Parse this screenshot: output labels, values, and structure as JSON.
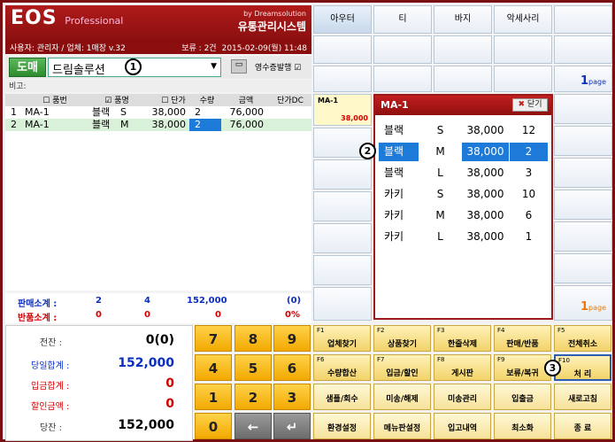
{
  "header": {
    "logo": "EOS",
    "logo_sub": "Professional",
    "by": "by Dreamsolution",
    "system": "유통관리시스템",
    "user_info": "사용자: 관리자 / 업체: 1매장 v.32",
    "hold": "보류 : 2건",
    "datetime": "2015-02-09(월) 11:48"
  },
  "select": {
    "mode": "도매",
    "customer": "드림솔루션",
    "receipt_label": "영수증발행"
  },
  "memo_label": "비고:",
  "table": {
    "headers": [
      "품번",
      "품명",
      "단가",
      "수량",
      "금액",
      "단가DC"
    ],
    "rows": [
      [
        "1",
        "MA-1",
        "블랙",
        "S",
        "38,000",
        "2",
        "76,000"
      ],
      [
        "2",
        "MA-1",
        "블랙",
        "M",
        "38,000",
        "2",
        "76,000"
      ]
    ]
  },
  "summary": {
    "sales_label": "판매소계 :",
    "sales": [
      "2",
      "4",
      "152,000",
      "(0)"
    ],
    "return_label": "반품소계 :",
    "returns": [
      "0",
      "0",
      "0",
      "0%"
    ]
  },
  "totals": [
    {
      "label": "전잔 :",
      "value": "0(0)",
      "color": "#000000"
    },
    {
      "label": "당일합계 :",
      "value": "152,000",
      "color": "#0b2fbf"
    },
    {
      "label": "입금합계 :",
      "value": "0",
      "color": "#d60000"
    },
    {
      "label": "할인금액 :",
      "value": "0",
      "color": "#d60000"
    },
    {
      "label": "당잔 :",
      "value": "152,000",
      "color": "#000000"
    }
  ],
  "keypad": [
    "7",
    "8",
    "9",
    "4",
    "5",
    "6",
    "1",
    "2",
    "3",
    "0",
    "←",
    "↵"
  ],
  "categories": [
    "아우터",
    "티",
    "바지",
    "악세사리"
  ],
  "page_top": {
    "num": "1",
    "label": "page"
  },
  "page_bottom": {
    "num": "1",
    "label": "page"
  },
  "product_tile": {
    "name": "MA-1",
    "price": "38,000"
  },
  "popup": {
    "title": "MA-1",
    "close": "닫기",
    "rows": [
      [
        "블랙",
        "S",
        "38,000",
        "12"
      ],
      [
        "블랙",
        "M",
        "38,000",
        "2"
      ],
      [
        "블랙",
        "L",
        "38,000",
        "3"
      ],
      [
        "카키",
        "S",
        "38,000",
        "10"
      ],
      [
        "카키",
        "M",
        "38,000",
        "6"
      ],
      [
        "카키",
        "L",
        "38,000",
        "1"
      ]
    ]
  },
  "fkeys": [
    {
      "n": "F1",
      "t": "업체찾기"
    },
    {
      "n": "F2",
      "t": "상품찾기"
    },
    {
      "n": "F3",
      "t": "한줄삭제"
    },
    {
      "n": "F4",
      "t": "판매/반품"
    },
    {
      "n": "F5",
      "t": "전체취소"
    },
    {
      "n": "F6",
      "t": "수량합산"
    },
    {
      "n": "F7",
      "t": "입금/할인"
    },
    {
      "n": "F8",
      "t": "게시판"
    },
    {
      "n": "F9",
      "t": "보류/복귀"
    },
    {
      "n": "F10",
      "t": "처 리"
    },
    {
      "n": "",
      "t": "샘플/회수"
    },
    {
      "n": "",
      "t": "미송/해제"
    },
    {
      "n": "",
      "t": "미송관리"
    },
    {
      "n": "",
      "t": "입출금"
    },
    {
      "n": "",
      "t": "새로고침"
    },
    {
      "n": "",
      "t": "환경설정"
    },
    {
      "n": "",
      "t": "메뉴판설정"
    },
    {
      "n": "",
      "t": "입고내역"
    },
    {
      "n": "",
      "t": "최소화"
    },
    {
      "n": "",
      "t": "종 료"
    }
  ],
  "markers": [
    "1",
    "2",
    "3"
  ],
  "colors": {
    "brand": "#9a1414",
    "accent": "#1e7ad8",
    "key": "#f2a900"
  }
}
